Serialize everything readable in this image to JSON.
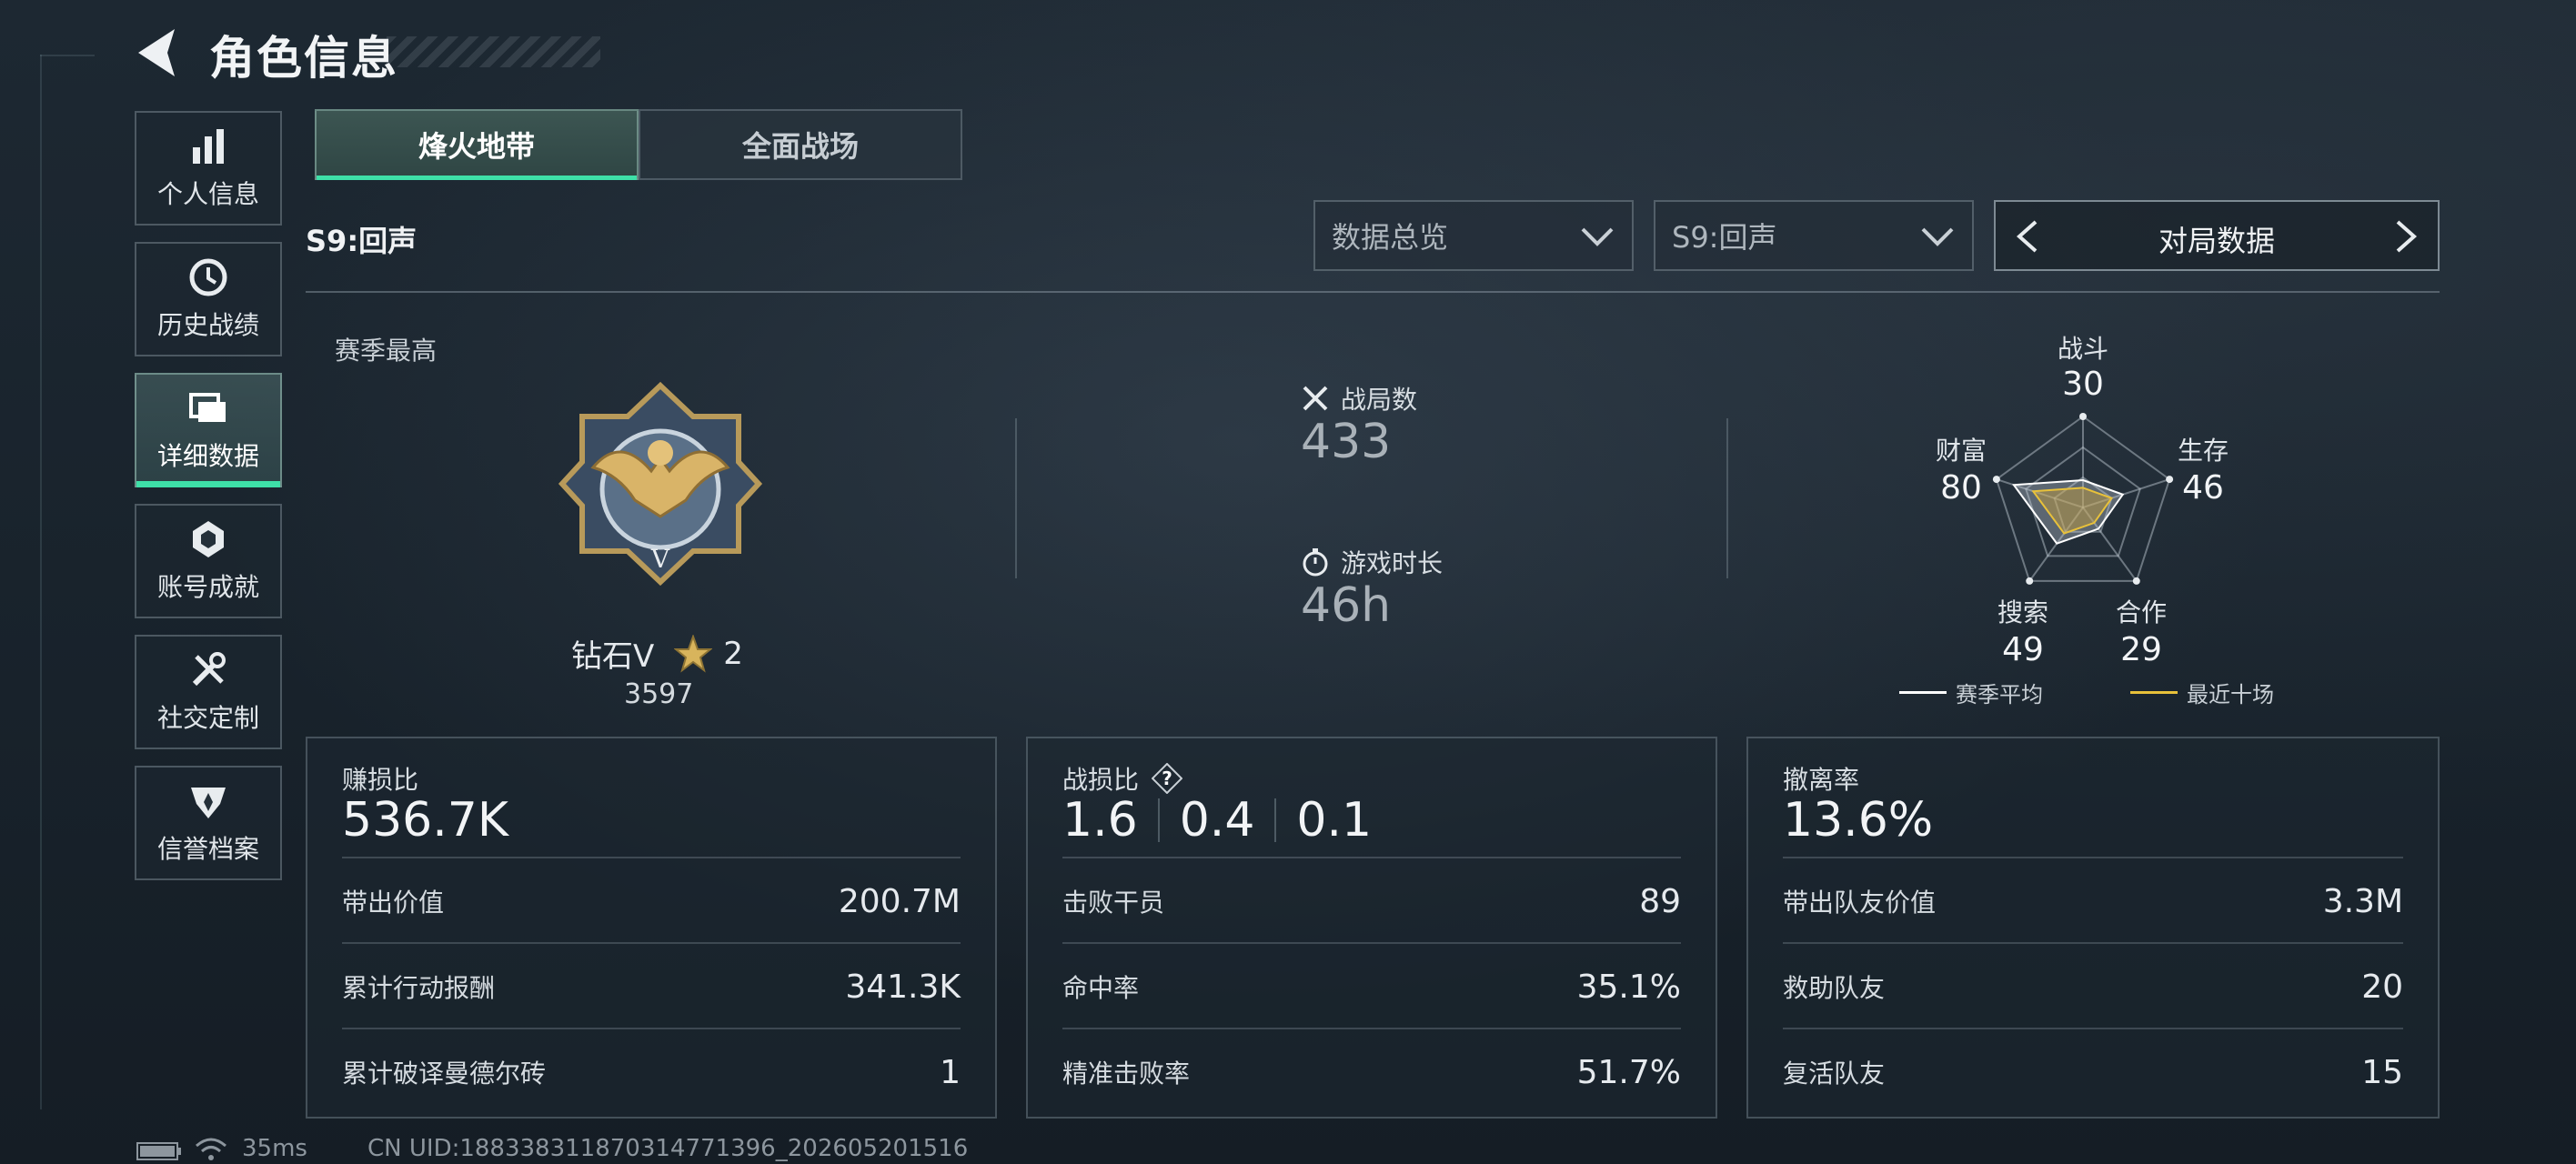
{
  "header": {
    "title": "角色信息"
  },
  "sidebar": {
    "items": [
      {
        "label": "个人信息",
        "icon": "bar-chart-icon"
      },
      {
        "label": "历史战绩",
        "icon": "clock-icon"
      },
      {
        "label": "详细数据",
        "icon": "cards-icon",
        "active": true
      },
      {
        "label": "账号成就",
        "icon": "achievement-icon"
      },
      {
        "label": "社交定制",
        "icon": "tools-icon"
      },
      {
        "label": "信誉档案",
        "icon": "shield-icon"
      }
    ]
  },
  "tabs": [
    {
      "label": "烽火地带",
      "active": true
    },
    {
      "label": "全面战场",
      "active": false
    }
  ],
  "season_label": "S9:回声",
  "filters": {
    "data_type": "数据总览",
    "season": "S9:回声",
    "switcher": "对局数据"
  },
  "overview": {
    "season_best_label": "赛季最高",
    "rank_name": "钻石V",
    "rank_stars": "2",
    "rank_points": "3597",
    "matches_label": "战局数",
    "matches_value": "433",
    "playtime_label": "游戏时长",
    "playtime_value": "46h"
  },
  "radar": {
    "axes": [
      {
        "label": "战斗",
        "value": "30"
      },
      {
        "label": "生存",
        "value": "46"
      },
      {
        "label": "合作",
        "value": "29"
      },
      {
        "label": "搜索",
        "value": "49"
      },
      {
        "label": "财富",
        "value": "80"
      }
    ],
    "legend": [
      {
        "label": "赛季平均",
        "color": "#ffffff"
      },
      {
        "label": "最近十场",
        "color": "#e8c13a"
      }
    ]
  },
  "panels": {
    "profit": {
      "title": "赚损比",
      "value": "536.7K",
      "rows": [
        {
          "label": "带出价值",
          "value": "200.7M"
        },
        {
          "label": "累计行动报酬",
          "value": "341.3K"
        },
        {
          "label": "累计破译曼德尔砖",
          "value": "1"
        }
      ]
    },
    "combat": {
      "title": "战损比",
      "values": [
        "1.6",
        "0.4",
        "0.1"
      ],
      "rows": [
        {
          "label": "击败干员",
          "value": "89"
        },
        {
          "label": "命中率",
          "value": "35.1%"
        },
        {
          "label": "精准击败率",
          "value": "51.7%"
        }
      ]
    },
    "extract": {
      "title": "撤离率",
      "value": "13.6%",
      "rows": [
        {
          "label": "带出队友价值",
          "value": "3.3M"
        },
        {
          "label": "救助队友",
          "value": "20"
        },
        {
          "label": "复活队友",
          "value": "15"
        }
      ]
    }
  },
  "footer": {
    "ping": "35ms",
    "uid": "CN UID:1883383118703147713​96_202605201516"
  },
  "colors": {
    "accent": "#3ee0a8",
    "gold": "#e8c13a"
  }
}
